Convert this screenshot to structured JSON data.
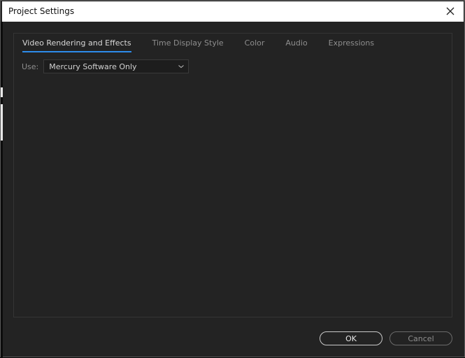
{
  "window": {
    "title": "Project Settings"
  },
  "tabs": [
    {
      "label": "Video Rendering and Effects",
      "active": true
    },
    {
      "label": "Time Display Style",
      "active": false
    },
    {
      "label": "Color",
      "active": false
    },
    {
      "label": "Audio",
      "active": false
    },
    {
      "label": "Expressions",
      "active": false
    }
  ],
  "renderer": {
    "label": "Use:",
    "value": "Mercury Software Only"
  },
  "footer": {
    "ok_label": "OK",
    "cancel_label": "Cancel"
  },
  "colors": {
    "background": "#232323",
    "accent": "#2d8ceb",
    "text_active": "#d8d8d8",
    "text_inactive": "#8e8e8e"
  },
  "icons": {
    "close": "close-icon",
    "dropdown": "chevron-down-icon"
  }
}
